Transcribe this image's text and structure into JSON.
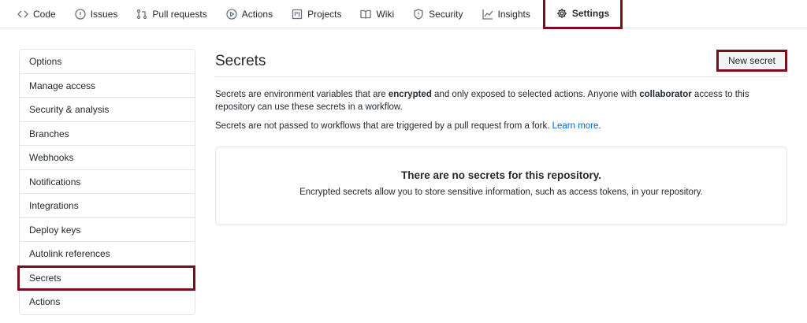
{
  "tabs": [
    {
      "label": "Code",
      "icon": "code-icon"
    },
    {
      "label": "Issues",
      "icon": "issue-icon"
    },
    {
      "label": "Pull requests",
      "icon": "pull-request-icon"
    },
    {
      "label": "Actions",
      "icon": "play-icon"
    },
    {
      "label": "Projects",
      "icon": "project-icon"
    },
    {
      "label": "Wiki",
      "icon": "book-icon"
    },
    {
      "label": "Security",
      "icon": "shield-icon"
    },
    {
      "label": "Insights",
      "icon": "graph-icon"
    },
    {
      "label": "Settings",
      "icon": "gear-icon",
      "selected": true
    }
  ],
  "sidebar": {
    "items": [
      "Options",
      "Manage access",
      "Security & analysis",
      "Branches",
      "Webhooks",
      "Notifications",
      "Integrations",
      "Deploy keys",
      "Autolink references",
      "Secrets",
      "Actions"
    ],
    "selected": "Secrets"
  },
  "main": {
    "title": "Secrets",
    "new_button": "New secret",
    "p1": {
      "a": "Secrets are environment variables that are ",
      "b": "encrypted",
      "c": " and only exposed to selected actions. Anyone with ",
      "d": "collaborator",
      "e": " access to this repository can use these secrets in a workflow."
    },
    "p2": {
      "text": "Secrets are not passed to workflows that are triggered by a pull request from a fork. ",
      "link": "Learn more",
      "end": "."
    },
    "empty": {
      "title": "There are no secrets for this repository.",
      "desc": "Encrypted secrets allow you to store sensitive information, such as access tokens, in your repository."
    }
  },
  "colors": {
    "highlight": "#7b0e1a",
    "link": "#0366d6"
  }
}
